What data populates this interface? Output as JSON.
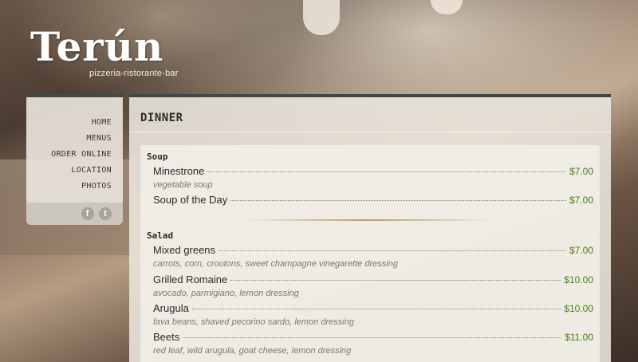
{
  "logo": {
    "title": "Terún",
    "subtitle": "pizzeria-ristorante-bar"
  },
  "nav": {
    "items": [
      "HOME",
      "MENUS",
      "ORDER ONLINE",
      "LOCATION",
      "PHOTOS"
    ]
  },
  "social": {
    "facebook_icon": "facebook-icon",
    "facebook_glyph": "f",
    "twitter_icon": "twitter-icon",
    "twitter_glyph": "t"
  },
  "page": {
    "title": "DINNER"
  },
  "menu": {
    "sections": [
      {
        "name": "Soup",
        "items": [
          {
            "name": "Minestrone",
            "price": "$7.00",
            "desc": "vegetable soup"
          },
          {
            "name": "Soup of the Day",
            "price": "$7.00",
            "desc": ""
          }
        ]
      },
      {
        "name": "Salad",
        "items": [
          {
            "name": "Mixed greens",
            "price": "$7.00",
            "desc": "carrots, corn, croutons, sweet champagne vinegarette dressing"
          },
          {
            "name": "Grilled Romaine",
            "price": "$10.00",
            "desc": "avocado, parmigiano, lemon dressing"
          },
          {
            "name": "Arugula",
            "price": "$10.00",
            "desc": "fava beans, shaved pecorino sardo, lemon dressing"
          },
          {
            "name": "Beets",
            "price": "$11.00",
            "desc": "red leaf, wild arugula, goat cheese, lemon dressing"
          }
        ]
      }
    ]
  },
  "colors": {
    "price": "#4e7d14",
    "panel_top_border": "#3e4a48"
  }
}
